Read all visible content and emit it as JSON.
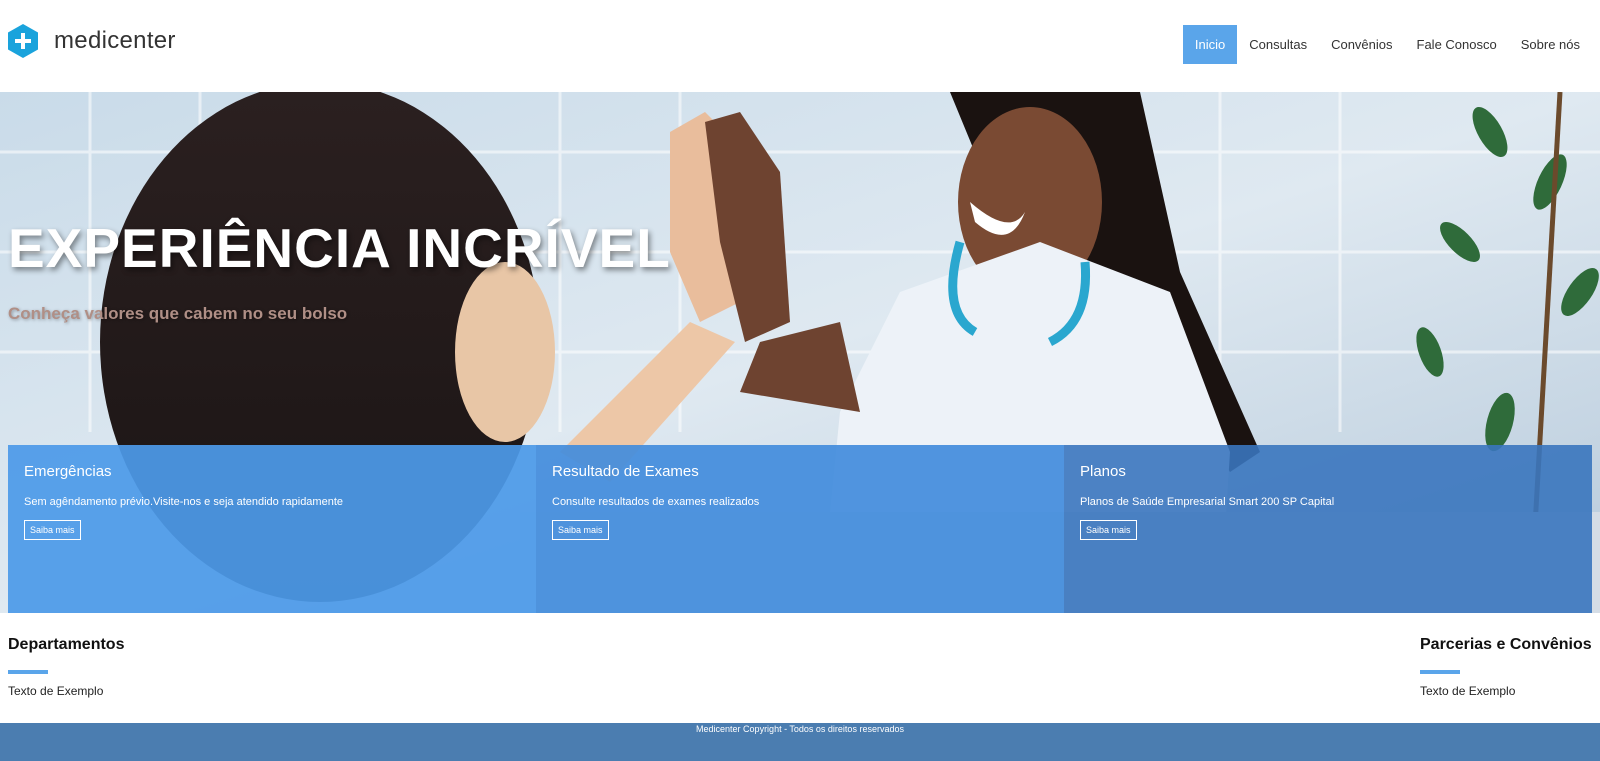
{
  "brand": {
    "name": "medicenter",
    "icon": "medical-cross-icon",
    "accent": "#5aa5ea"
  },
  "nav": {
    "items": [
      {
        "label": "Inicio",
        "active": true
      },
      {
        "label": "Consultas",
        "active": false
      },
      {
        "label": "Convênios",
        "active": false
      },
      {
        "label": "Fale Conosco",
        "active": false
      },
      {
        "label": "Sobre nós",
        "active": false
      }
    ]
  },
  "hero": {
    "title": "EXPERIÊNCIA INCRÍVEL",
    "subtitle": "Conheça valores que cabem no seu bolso",
    "cards": [
      {
        "title": "Emergências",
        "text": "Sem agêndamento prévio.Visite-nos e seja atendido rapidamente",
        "button": "Saiba mais"
      },
      {
        "title": "Resultado de Exames",
        "text": "Consulte resultados de exames realizados",
        "button": "Saiba mais"
      },
      {
        "title": "Planos",
        "text": "Planos de Saúde Empresarial Smart 200 SP Capital",
        "button": "Saiba mais"
      }
    ]
  },
  "sections": {
    "departments": {
      "title": "Departamentos",
      "text": "Texto de Exemplo"
    },
    "partners": {
      "title": "Parcerias e Convênios",
      "text": "Texto de Exemplo"
    }
  },
  "footer": {
    "text": "Medicenter Copyright - Todos os direitos reservados",
    "color": "#4b7db0"
  }
}
